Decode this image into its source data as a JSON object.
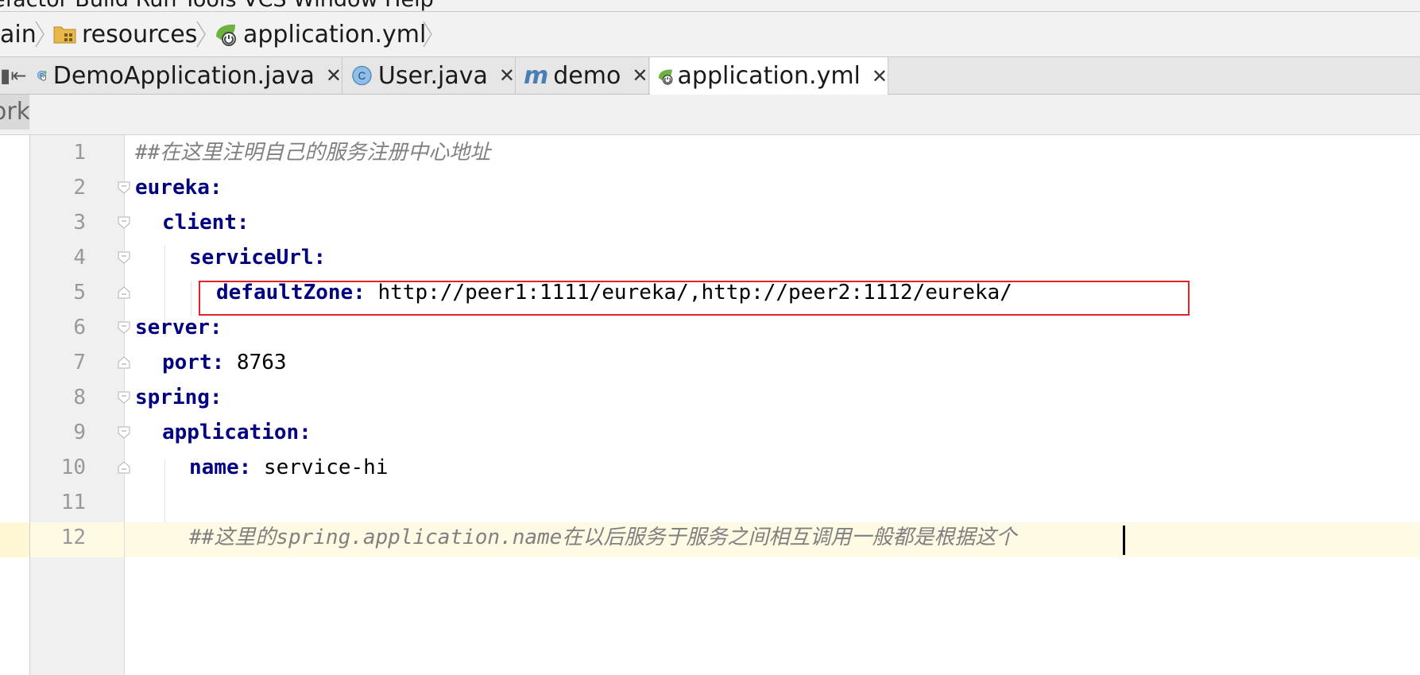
{
  "menubar": {
    "partial_text": "efactor  Build  Run  Tools  VCS  Window  Help"
  },
  "breadcrumb": {
    "items": [
      {
        "label": "ain",
        "icon": "none"
      },
      {
        "label": "resources",
        "icon": "resources-folder-icon"
      },
      {
        "label": "application.yml",
        "icon": "spring-config-icon"
      }
    ]
  },
  "tabs": [
    {
      "label": "DemoApplication.java",
      "icon": "spring-boot-class-icon",
      "active": false
    },
    {
      "label": "User.java",
      "icon": "class-icon",
      "active": false
    },
    {
      "label": "demo",
      "icon": "maven-icon",
      "active": false
    },
    {
      "label": "application.yml",
      "icon": "spring-config-icon",
      "active": true
    }
  ],
  "strip": {
    "left_text": "ork"
  },
  "editor": {
    "lines": [
      {
        "num": "1",
        "key": "",
        "value": "",
        "comment": "##在这里注明自己的服务注册中心地址"
      },
      {
        "num": "2",
        "key": "eureka:",
        "value": "",
        "comment": ""
      },
      {
        "num": "3",
        "key": "client:",
        "value": "",
        "comment": ""
      },
      {
        "num": "4",
        "key": "serviceUrl:",
        "value": "",
        "comment": ""
      },
      {
        "num": "5",
        "key": "defaultZone:",
        "value": " http://peer1:1111/eureka/,http://peer2:1112/eureka/",
        "comment": ""
      },
      {
        "num": "6",
        "key": "server:",
        "value": "",
        "comment": ""
      },
      {
        "num": "7",
        "key": "port:",
        "value": " 8763",
        "comment": ""
      },
      {
        "num": "8",
        "key": "spring:",
        "value": "",
        "comment": ""
      },
      {
        "num": "9",
        "key": "application:",
        "value": "",
        "comment": ""
      },
      {
        "num": "10",
        "key": "name:",
        "value": " service-hi",
        "comment": ""
      },
      {
        "num": "11",
        "key": "",
        "value": "",
        "comment": ""
      },
      {
        "num": "12",
        "key": "",
        "value": "",
        "comment": "##这里的spring.application.name在以后服务于服务之间相互调用一般都是根据这个"
      }
    ]
  },
  "colors": {
    "key": "#000080",
    "comment": "#808080",
    "highlight_border": "#e0242c",
    "current_line": "#fffae3"
  }
}
